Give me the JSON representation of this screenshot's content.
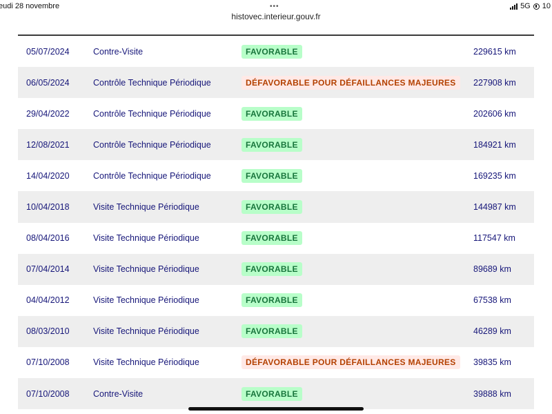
{
  "status": {
    "time_day": "eudi 28 novembre",
    "network": "5G",
    "battery_partial": "10"
  },
  "browser": {
    "url": "histovec.interieur.gouv.fr"
  },
  "colors": {
    "favorable_bg": "#b8fec9",
    "favorable_text": "#18753c",
    "defavorable_bg": "#ffe9e6",
    "defavorable_text": "#b34000",
    "link_text": "#161679"
  },
  "rows": [
    {
      "date": "05/07/2024",
      "type": "Contre-Visite",
      "result": "FAVORABLE",
      "status": "ok",
      "km": "229615 km"
    },
    {
      "date": "06/05/2024",
      "type": "Contrôle Technique Périodique",
      "result": "DÉFAVORABLE POUR DÉFAILLANCES MAJEURES",
      "status": "ko",
      "km": "227908 km"
    },
    {
      "date": "29/04/2022",
      "type": "Contrôle Technique Périodique",
      "result": "FAVORABLE",
      "status": "ok",
      "km": "202606 km"
    },
    {
      "date": "12/08/2021",
      "type": "Contrôle Technique Périodique",
      "result": "FAVORABLE",
      "status": "ok",
      "km": "184921 km"
    },
    {
      "date": "14/04/2020",
      "type": "Contrôle Technique Périodique",
      "result": "FAVORABLE",
      "status": "ok",
      "km": "169235 km"
    },
    {
      "date": "10/04/2018",
      "type": "Visite Technique Périodique",
      "result": "FAVORABLE",
      "status": "ok",
      "km": "144987 km"
    },
    {
      "date": "08/04/2016",
      "type": "Visite Technique Périodique",
      "result": "FAVORABLE",
      "status": "ok",
      "km": "117547 km"
    },
    {
      "date": "07/04/2014",
      "type": "Visite Technique Périodique",
      "result": "FAVORABLE",
      "status": "ok",
      "km": "89689 km"
    },
    {
      "date": "04/04/2012",
      "type": "Visite Technique Périodique",
      "result": "FAVORABLE",
      "status": "ok",
      "km": "67538 km"
    },
    {
      "date": "08/03/2010",
      "type": "Visite Technique Périodique",
      "result": "FAVORABLE",
      "status": "ok",
      "km": "46289 km"
    },
    {
      "date": "07/10/2008",
      "type": "Visite Technique Périodique",
      "result": "DÉFAVORABLE POUR DÉFAILLANCES MAJEURES",
      "status": "ko",
      "km": "39835 km"
    },
    {
      "date": "07/10/2008",
      "type": "Contre-Visite",
      "result": "FAVORABLE",
      "status": "ok",
      "km": "39888 km"
    }
  ]
}
